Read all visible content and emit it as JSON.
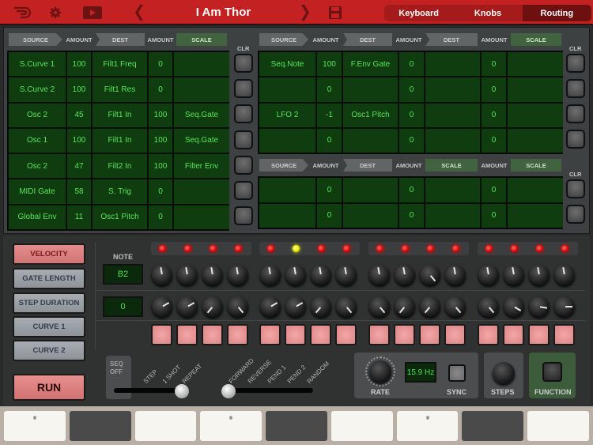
{
  "topbar": {
    "icons": [
      "logo-icon",
      "gear-icon",
      "video-icon",
      "prev-chevron-icon",
      "next-chevron-icon",
      "save-disk-icon"
    ],
    "title": "I Am Thor",
    "tabs": [
      {
        "label": "Keyboard",
        "active": false
      },
      {
        "label": "Knobs",
        "active": false
      },
      {
        "label": "Routing",
        "active": true
      }
    ]
  },
  "routing": {
    "left": {
      "headers": [
        "SOURCE",
        "AMOUNT",
        "DEST",
        "AMOUNT",
        "SCALE"
      ],
      "clr_label": "CLR",
      "rows": [
        [
          "S.Curve 1",
          "100",
          "Filt1 Freq",
          "0",
          ""
        ],
        [
          "S.Curve 2",
          "100",
          "Filt1 Res",
          "0",
          ""
        ],
        [
          "Osc 2",
          "45",
          "Filt1 In",
          "100",
          "Seq.Gate"
        ],
        [
          "Osc 1",
          "100",
          "Filt1 In",
          "100",
          "Seq.Gate"
        ],
        [
          "Osc 2",
          "47",
          "Filt2 In",
          "100",
          "Filter Env"
        ],
        [
          "MIDI Gate",
          "58",
          "S. Trig",
          "0",
          ""
        ],
        [
          "Global Env",
          "11",
          "Osc1 Pitch",
          "0",
          ""
        ]
      ]
    },
    "right_top": {
      "headers": [
        "SOURCE",
        "AMOUNT",
        "DEST",
        "AMOUNT",
        "DEST",
        "AMOUNT",
        "SCALE"
      ],
      "clr_label": "CLR",
      "rows": [
        [
          "Seq.Note",
          "100",
          "F.Env Gate",
          "0",
          "",
          "0",
          ""
        ],
        [
          "",
          "0",
          "",
          "0",
          "",
          "0",
          ""
        ],
        [
          "LFO 2",
          "-1",
          "Osc1 Pitch",
          "0",
          "",
          "0",
          ""
        ],
        [
          "",
          "0",
          "",
          "0",
          "",
          "0",
          ""
        ]
      ]
    },
    "right_bottom": {
      "headers": [
        "SOURCE",
        "AMOUNT",
        "DEST",
        "AMOUNT",
        "SCALE",
        "AMOUNT",
        "SCALE"
      ],
      "clr_label": "CLR",
      "rows": [
        [
          "",
          "0",
          "",
          "0",
          "",
          "0",
          ""
        ],
        [
          "",
          "0",
          "",
          "0",
          "",
          "0",
          ""
        ]
      ]
    }
  },
  "sequencer": {
    "modes": [
      {
        "label": "VELOCITY",
        "active": true
      },
      {
        "label": "GATE LENGTH",
        "active": false
      },
      {
        "label": "STEP DURATION",
        "active": false
      },
      {
        "label": "CURVE 1",
        "active": false
      },
      {
        "label": "CURVE 2",
        "active": false
      }
    ],
    "run_label": "RUN",
    "note_label": "NOTE",
    "note_value": "B2",
    "row2_value": "0",
    "active_step": 6,
    "step_count": 16,
    "row1_knob_angles_deg": [
      -10,
      -10,
      -10,
      -10,
      -10,
      -10,
      -10,
      -10,
      -10,
      -10,
      140,
      -10,
      -10,
      -10,
      -10,
      -10
    ],
    "row2_knob_angles_deg": [
      60,
      60,
      220,
      140,
      60,
      60,
      220,
      140,
      140,
      220,
      220,
      140,
      140,
      120,
      100,
      90
    ],
    "seq_off_label": [
      "SEQ",
      "OFF"
    ],
    "play_mode_labels": [
      "STEP",
      "1 SHOT",
      "REPEAT"
    ],
    "play_mode_selected": "REPEAT",
    "direction_labels": [
      "FORWARD",
      "REVERSE",
      "PEND 1",
      "PEND 2",
      "RANDOM"
    ],
    "direction_selected": "FORWARD",
    "rate_label": "RATE",
    "rate_value": "15.9 Hz",
    "sync_label": "SYNC",
    "steps_label": "STEPS",
    "function_label": "FUNCTION"
  },
  "keyboard": {
    "keys": [
      {
        "color": "white",
        "dot": true
      },
      {
        "color": "dark",
        "dot": false
      },
      {
        "color": "white",
        "dot": false
      },
      {
        "color": "white",
        "dot": true
      },
      {
        "color": "dark",
        "dot": false
      },
      {
        "color": "white",
        "dot": false
      },
      {
        "color": "white",
        "dot": true
      },
      {
        "color": "dark",
        "dot": false
      },
      {
        "color": "white",
        "dot": false
      }
    ]
  }
}
